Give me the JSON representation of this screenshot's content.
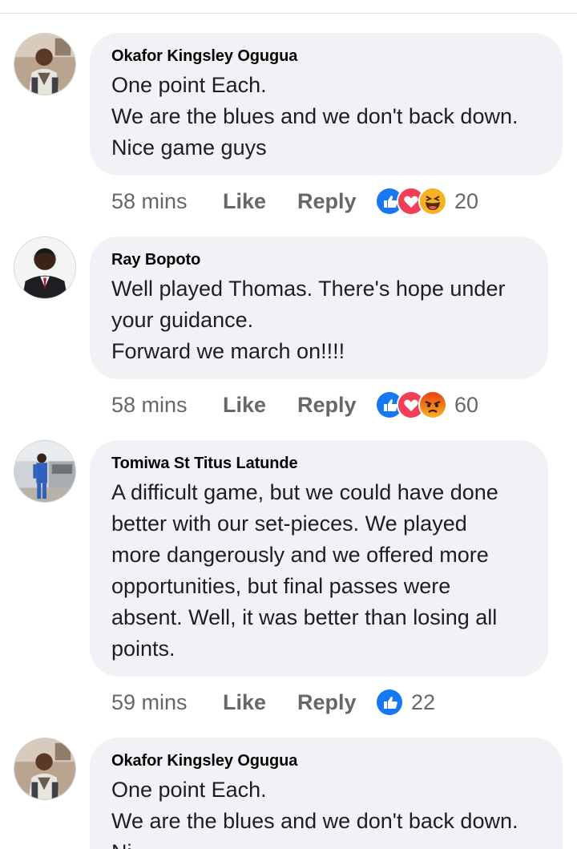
{
  "comments": [
    {
      "author": "Okafor Kingsley Ogugua",
      "lines": [
        "One point Each.",
        "We are the blues and we don't back down.",
        "Nice game guys"
      ],
      "time": "58 mins",
      "like_label": "Like",
      "reply_label": "Reply",
      "reactions": [
        "like",
        "love",
        "haha"
      ],
      "reaction_count": "20"
    },
    {
      "author": "Ray Bopoto",
      "lines": [
        "Well played Thomas. There's hope under",
        "your guidance.",
        "Forward we march on!!!!"
      ],
      "time": "58 mins",
      "like_label": "Like",
      "reply_label": "Reply",
      "reactions": [
        "like",
        "love",
        "angry"
      ],
      "reaction_count": "60"
    },
    {
      "author": "Tomiwa St Titus Latunde",
      "lines": [
        "A difficult game, but we could have done",
        "better with our set-pieces. We played",
        "more dangerously and we offered more",
        "opportunities, but final passes were",
        "absent. Well, it was better than losing all",
        "points."
      ],
      "time": "59 mins",
      "like_label": "Like",
      "reply_label": "Reply",
      "reactions": [
        "like"
      ],
      "reaction_count": "22"
    },
    {
      "author": "Okafor Kingsley Ogugua",
      "lines": [
        "One point Each.",
        "We are the blues and we don't back down.",
        "Ni"
      ]
    }
  ],
  "colors": {
    "bubble": "#f0f2f5",
    "meta_text": "#65676b",
    "like_blue": "#1877f2",
    "love_red": "#f33e58",
    "haha_yellow": "#f7b125",
    "angry_orange": "#e9710f"
  }
}
